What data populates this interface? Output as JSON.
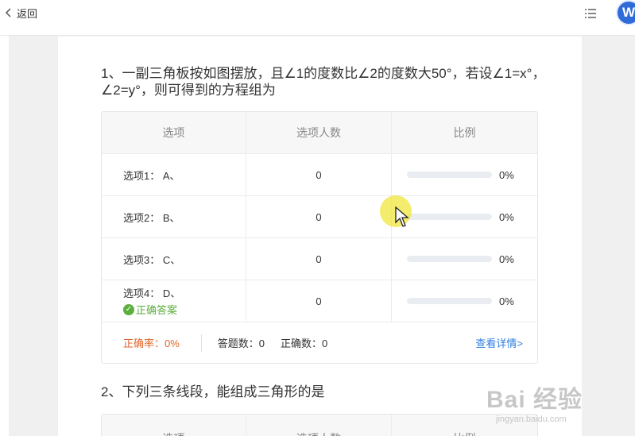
{
  "topbar": {
    "back_label": "返回"
  },
  "question1": {
    "title": "1、一副三角板按如图摆放，且∠1的度数比∠2的度数大50°，若设∠1=x°，∠2=y°，则可得到的方程组为",
    "headers": [
      "选项",
      "选项人数",
      "比例"
    ],
    "rows": [
      {
        "option": "选项1： A、",
        "count": "0",
        "ratio": "0%",
        "fill": 0
      },
      {
        "option": "选项2： B、",
        "count": "0",
        "ratio": "0%",
        "fill": 0
      },
      {
        "option": "选项3： C、",
        "count": "0",
        "ratio": "0%",
        "fill": 0
      },
      {
        "option": "选项4： D、",
        "count": "0",
        "ratio": "0%",
        "fill": 0,
        "correct_label": "正确答案"
      }
    ],
    "footer": {
      "rate": "正确率：0%",
      "answers": "答题数：0",
      "correct_count": "正确数：0",
      "detail_link": "查看详情>"
    }
  },
  "question2": {
    "title": "2、下列三条线段，能组成三角形的是",
    "headers": [
      "选项",
      "选项人数",
      "比例"
    ]
  },
  "avatar_letter": "W",
  "watermark": {
    "main": "Bai 经验",
    "sub": "jingyan.baidu.com"
  },
  "colors": {
    "accent": "#2f7de1",
    "correct": "#5cae3e",
    "rate": "#e0662b"
  }
}
